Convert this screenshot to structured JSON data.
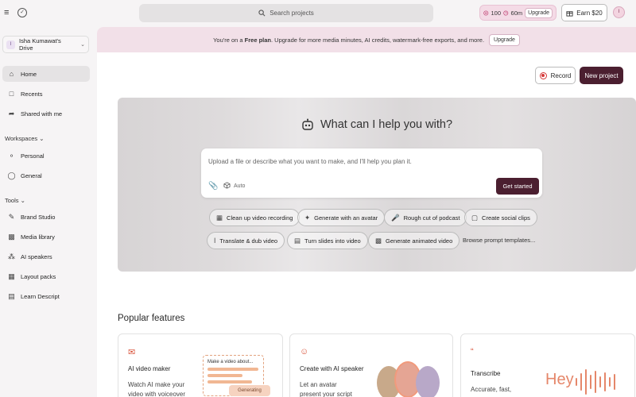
{
  "topbar": {
    "search_placeholder": "Search projects",
    "credits": "100",
    "minutes": "60m",
    "upgrade_label": "Upgrade",
    "earn_label": "Earn $20",
    "avatar_initial": "I"
  },
  "sidebar": {
    "drive_initial": "I",
    "drive_name": "Isha Kumawat's Drive",
    "nav": [
      {
        "label": "Home",
        "icon": "home-icon"
      },
      {
        "label": "Recents",
        "icon": "recents-icon"
      },
      {
        "label": "Shared with me",
        "icon": "shared-icon"
      }
    ],
    "workspaces_label": "Workspaces",
    "workspaces": [
      {
        "label": "Personal",
        "icon": "person-icon"
      },
      {
        "label": "General",
        "icon": "group-icon"
      }
    ],
    "tools_label": "Tools",
    "tools": [
      {
        "label": "Brand Studio",
        "icon": "brand-icon"
      },
      {
        "label": "Media library",
        "icon": "media-icon"
      },
      {
        "label": "AI speakers",
        "icon": "speaker-icon"
      },
      {
        "label": "Layout packs",
        "icon": "layout-icon"
      },
      {
        "label": "Learn Descript",
        "icon": "book-icon"
      }
    ]
  },
  "banner": {
    "text_before": "You're on a",
    "plan": "Free plan",
    "text_after": ". Upgrade for more media minutes, AI credits, watermark-free exports, and more.",
    "button": "Upgrade"
  },
  "actions": {
    "record": "Record",
    "new_project": "New project"
  },
  "hero": {
    "title": "What can I help you with?",
    "prompt_placeholder": "Upload a file or describe what you want to make, and I'll help you plan it.",
    "auto_label": "Auto",
    "get_started": "Get started",
    "chips": [
      "Clean up video recording",
      "Generate with an avatar",
      "Rough cut of podcast",
      "Create social clips",
      "Translate & dub video",
      "Turn slides into video",
      "Generate animated video"
    ],
    "browse": "Browse prompt templates..."
  },
  "popular": {
    "title": "Popular features",
    "cards": [
      {
        "title": "AI video maker",
        "desc": "Watch AI make your video with voiceover",
        "mock_title": "Make a video about...",
        "mock_button": "Generating"
      },
      {
        "title": "Create with AI speaker",
        "desc": "Let an avatar present your script — no need to"
      },
      {
        "title": "Transcribe",
        "desc": "Accurate, fast, across",
        "mock_text": "Hey"
      }
    ]
  },
  "colors": {
    "accent": "#4b1f30",
    "banner_bg": "#f2e0e8",
    "record_red": "#d43838",
    "feature_orange": "#d9533a"
  }
}
